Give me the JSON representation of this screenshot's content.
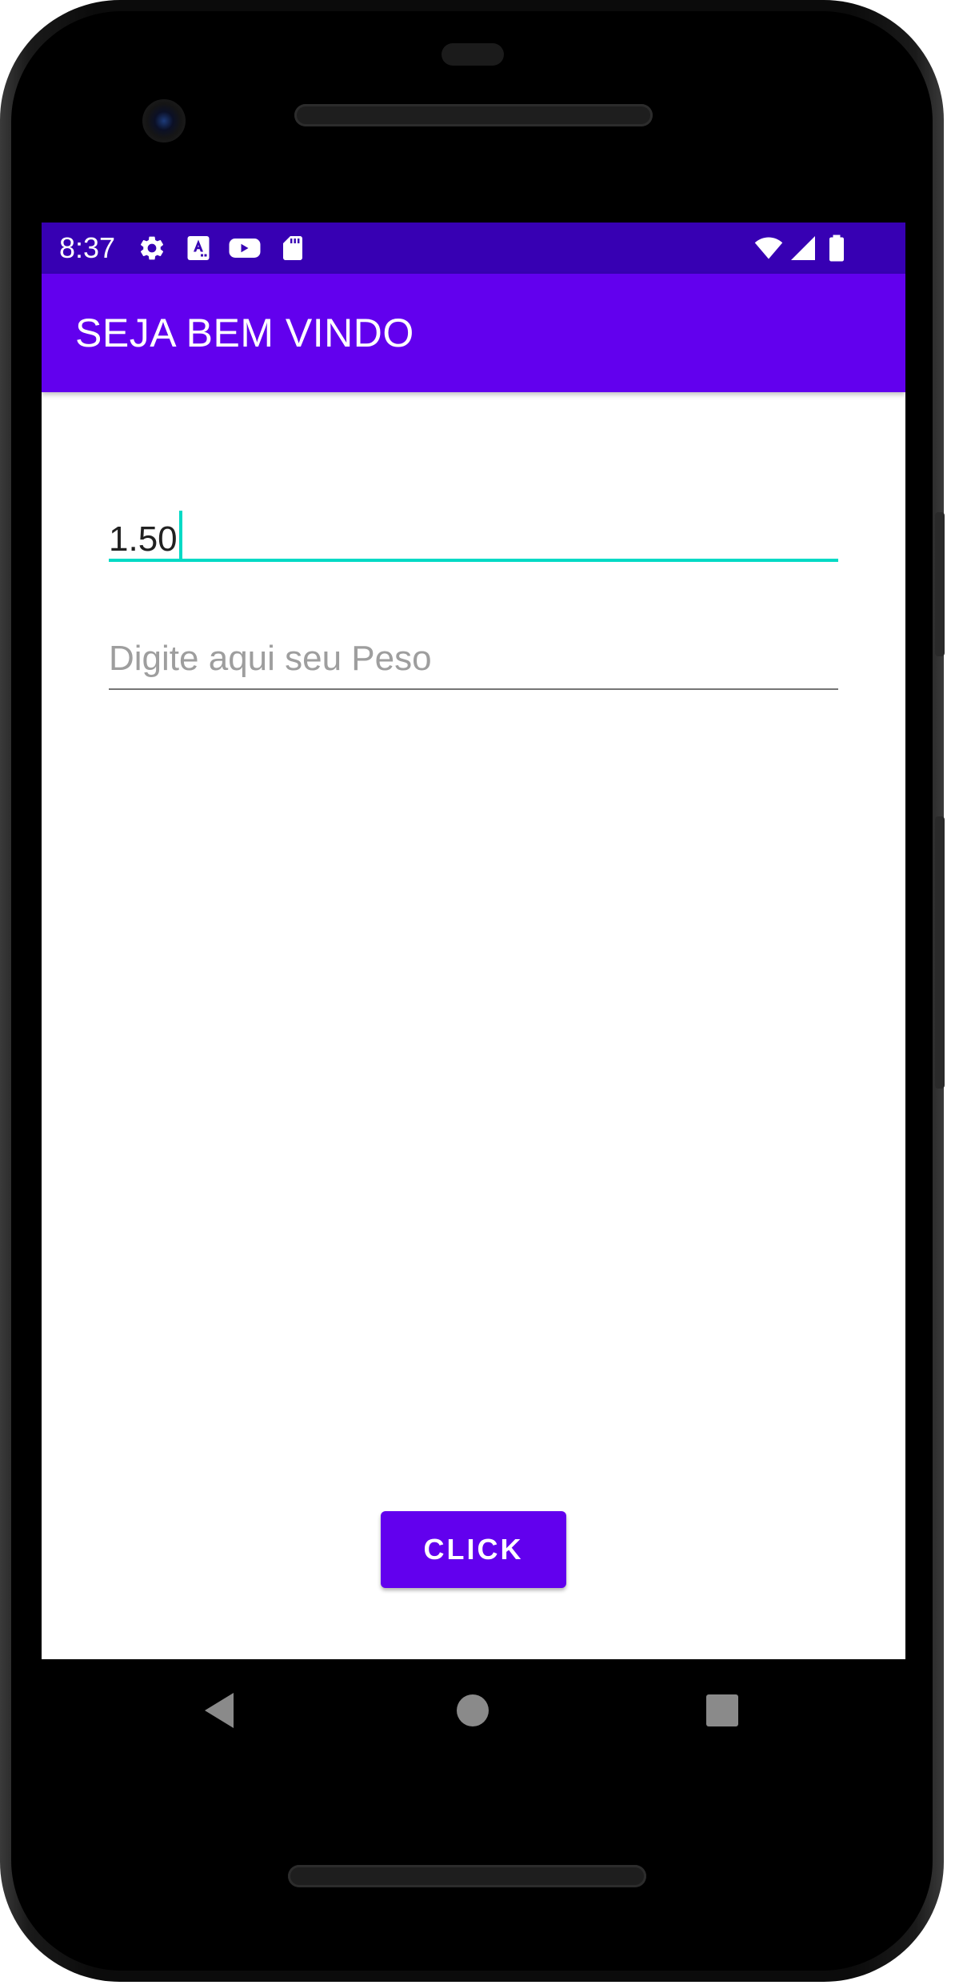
{
  "status_bar": {
    "time": "8:37",
    "icons_left": [
      "settings-icon",
      "translate-a-icon",
      "youtube-icon",
      "sd-card-icon"
    ],
    "icons_right": [
      "wifi-icon",
      "cellular-signal-icon",
      "battery-icon"
    ]
  },
  "app_bar": {
    "title": "SEJA BEM VINDO"
  },
  "form": {
    "height_field": {
      "value": "1.50",
      "focused": true
    },
    "weight_field": {
      "value": "",
      "placeholder": "Digite aqui seu Peso"
    },
    "submit_label": "CLICK"
  },
  "nav_bar": {
    "icons": [
      "back-icon",
      "home-icon",
      "recents-icon"
    ]
  },
  "colors": {
    "status_bar": "#3700b3",
    "primary": "#6200ee",
    "accent": "#03dac5",
    "nav_icon": "#8a8a8a"
  }
}
